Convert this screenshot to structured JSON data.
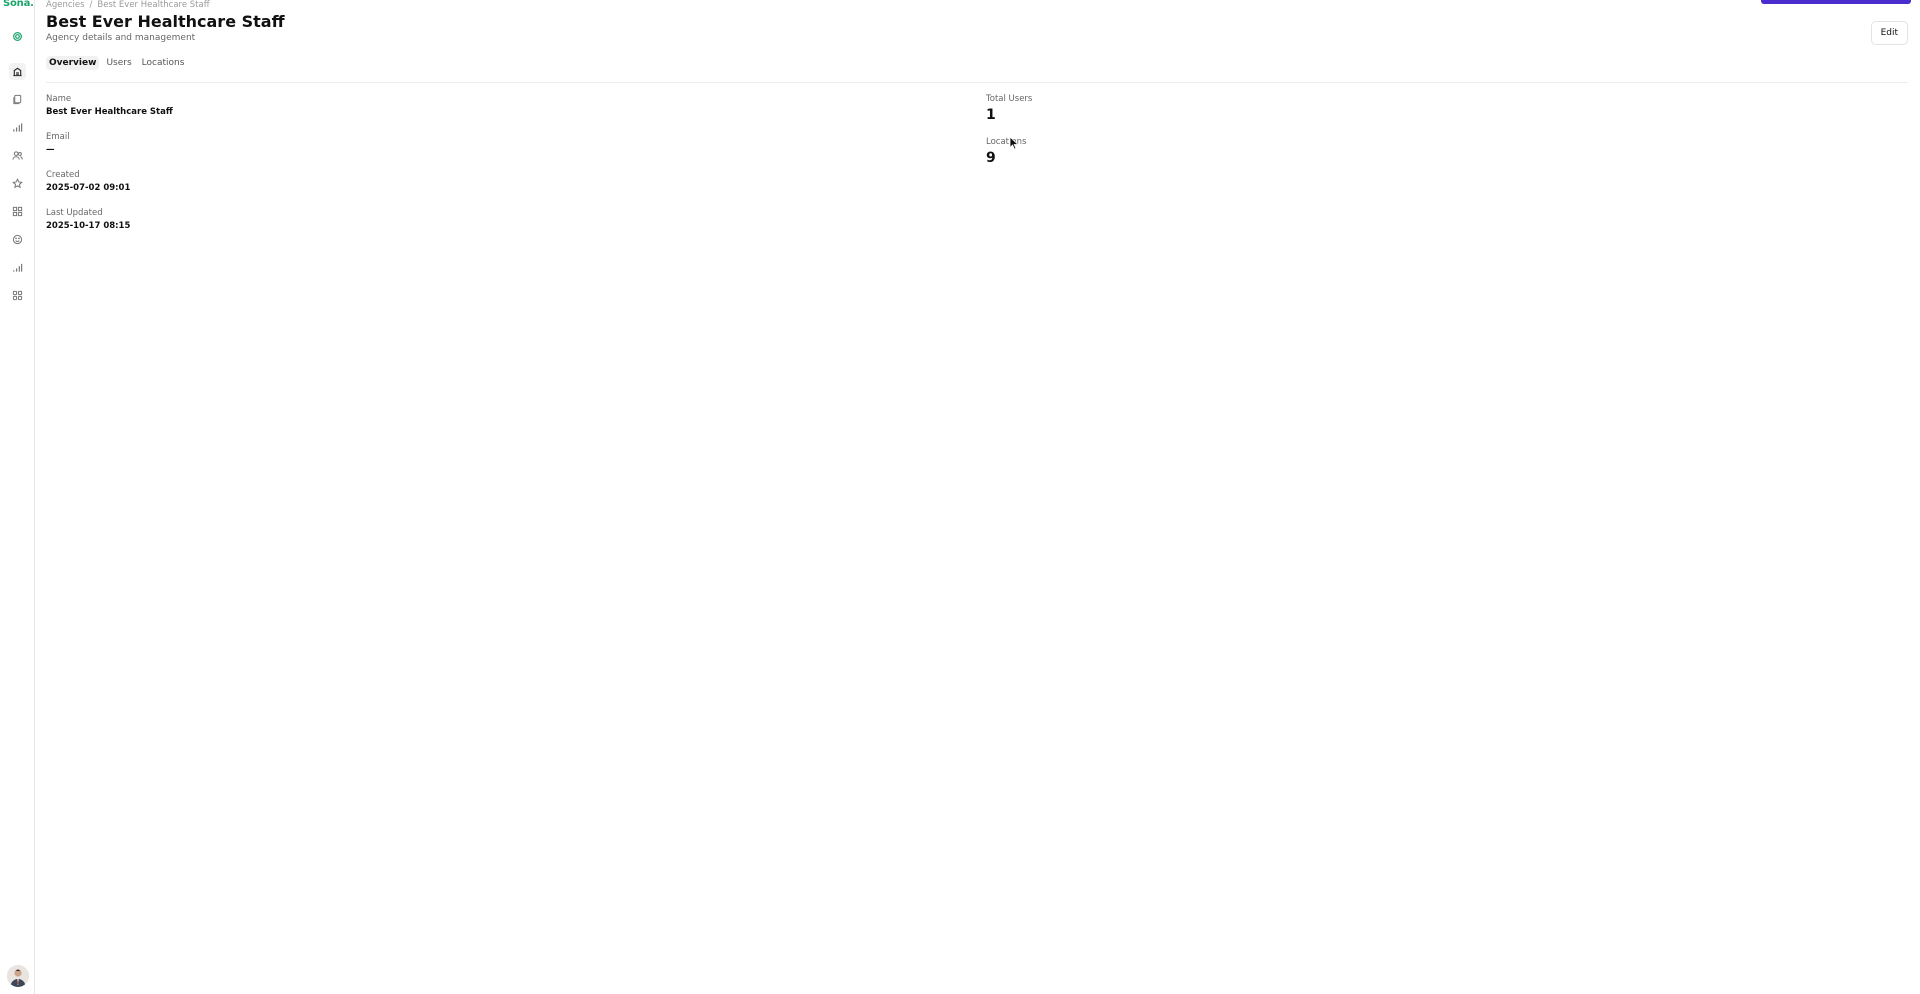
{
  "app": {
    "logo_text": "Sona.",
    "brand_color": "#1aa56b",
    "accent_color": "#4b2ccf"
  },
  "sidebar": {
    "items": [
      {
        "icon": "settings-icon",
        "active": false
      },
      {
        "icon": "building-icon",
        "active": true
      },
      {
        "icon": "documents-icon",
        "active": false
      },
      {
        "icon": "bar-chart-icon",
        "active": false
      },
      {
        "icon": "users-icon",
        "active": false
      },
      {
        "icon": "star-icon",
        "active": false
      },
      {
        "icon": "grid-icon",
        "active": false
      },
      {
        "icon": "smile-icon",
        "active": false
      },
      {
        "icon": "signal-icon",
        "active": false
      },
      {
        "icon": "apps-icon",
        "active": false
      }
    ],
    "avatar_icon": "user-avatar"
  },
  "breadcrumb": {
    "items": [
      "Agencies",
      "Best Ever Healthcare Staff"
    ],
    "separator": "/"
  },
  "header": {
    "title": "Best Ever Healthcare Staff",
    "subtitle": "Agency details and management",
    "edit_label": "Edit"
  },
  "tabs": [
    {
      "label": "Overview",
      "active": true
    },
    {
      "label": "Users",
      "active": false
    },
    {
      "label": "Locations",
      "active": false
    }
  ],
  "details": {
    "name_label": "Name",
    "name_value": "Best Ever Healthcare Staff",
    "email_label": "Email",
    "email_value": "—",
    "created_label": "Created",
    "created_value": "2025-07-02 09:01",
    "updated_label": "Last Updated",
    "updated_value": "2025-10-17 08:15"
  },
  "stats": {
    "total_users_label": "Total Users",
    "total_users_value": "1",
    "locations_label": "Locations",
    "locations_value": "9"
  }
}
